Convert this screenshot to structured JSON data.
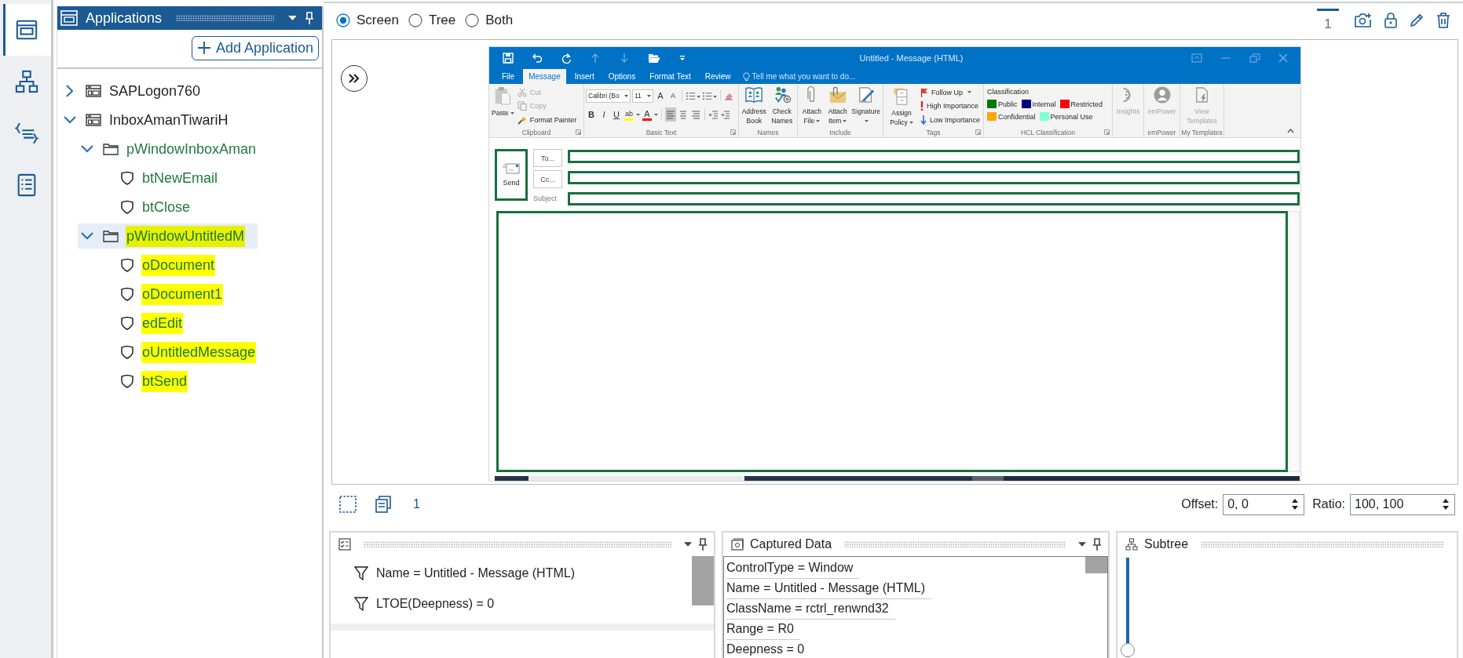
{
  "side_rail": [
    {
      "selected": true
    },
    {
      "selected": false
    },
    {
      "selected": false
    },
    {
      "selected": false
    }
  ],
  "applications": {
    "title": "Applications",
    "add_button": "Add Application",
    "tree": [
      {
        "label": "SAPLogon760",
        "kind": "application",
        "expanded": false,
        "selected": false,
        "highlighted": false
      },
      {
        "label": "InboxAmanTiwariH",
        "kind": "application",
        "expanded": true,
        "selected": false,
        "highlighted": false,
        "children": [
          {
            "label": "pWindowInboxAman",
            "kind": "window",
            "expanded": true,
            "selected": false,
            "highlighted": false,
            "children": [
              {
                "label": "btNewEmail",
                "kind": "element",
                "selected": false,
                "highlighted": false
              },
              {
                "label": "btClose",
                "kind": "element",
                "selected": false,
                "highlighted": false
              }
            ]
          },
          {
            "label": "pWindowUntitledM",
            "kind": "window",
            "expanded": true,
            "selected": true,
            "highlighted": true,
            "children": [
              {
                "label": "oDocument",
                "kind": "element",
                "selected": false,
                "highlighted": true
              },
              {
                "label": "oDocument1",
                "kind": "element",
                "selected": false,
                "highlighted": true
              },
              {
                "label": "edEdit",
                "kind": "element",
                "selected": false,
                "highlighted": true
              },
              {
                "label": "oUntitledMessage",
                "kind": "element",
                "selected": false,
                "highlighted": true
              },
              {
                "label": "btSend",
                "kind": "element",
                "selected": false,
                "highlighted": true
              }
            ]
          }
        ]
      }
    ]
  },
  "view_modes": [
    {
      "label": "Screen",
      "selected": true
    },
    {
      "label": "Tree",
      "selected": false
    },
    {
      "label": "Both",
      "selected": false
    }
  ],
  "screen_tabs": [
    {
      "label": "1",
      "selected": true
    }
  ],
  "outlook": {
    "title": "Untitled - Message (HTML)",
    "quick_access": [
      {
        "disabled": false
      },
      {
        "disabled": false
      },
      {
        "disabled": false
      },
      {
        "disabled": true
      },
      {
        "disabled": true
      },
      {
        "disabled": false
      },
      {
        "disabled": false
      }
    ],
    "tabs": [
      {
        "label": "File",
        "selected": false
      },
      {
        "label": "Message",
        "selected": true
      },
      {
        "label": "Insert",
        "selected": false
      },
      {
        "label": "Options",
        "selected": false
      },
      {
        "label": "Format Text",
        "selected": false
      },
      {
        "label": "Review",
        "selected": false
      }
    ],
    "tell_me": "Tell me what you want to do...",
    "ribbon": [
      {
        "kind": "clipboard",
        "label": "Clipboard",
        "launcher": true,
        "paste": {
          "label": "Paste",
          "dropdown": true
        },
        "items": [
          {
            "label": "Cut",
            "disabled": true
          },
          {
            "label": "Copy",
            "disabled": true
          },
          {
            "label": "Format Painter",
            "disabled": false
          }
        ]
      },
      {
        "kind": "basic_text",
        "label": "Basic Text",
        "launcher": true,
        "font": "Calibri (Bo",
        "size": "11",
        "grow": "A",
        "shrink": "A",
        "styles": [
          "B",
          "I",
          "U"
        ],
        "highlight": "ab",
        "font_color": "A",
        "alignments": [
          {
            "selected": true
          },
          {
            "selected": false
          },
          {
            "selected": false
          }
        ]
      },
      {
        "kind": "names",
        "label": "Names",
        "buttons": [
          {
            "label": "Address Book",
            "dropdown": false,
            "disabled": false
          },
          {
            "label": "Check Names",
            "dropdown": false,
            "disabled": false
          }
        ]
      },
      {
        "kind": "include",
        "label": "Include",
        "buttons": [
          {
            "label": "Attach File",
            "dropdown": true,
            "disabled": false
          },
          {
            "label": "Attach Item",
            "dropdown": true,
            "disabled": false
          },
          {
            "label": "Signature",
            "dropdown": true,
            "disabled": false
          }
        ]
      },
      {
        "kind": "tags",
        "label": "Tags",
        "launcher": true,
        "policy": {
          "label": "Assign Policy",
          "dropdown": true
        },
        "items": [
          {
            "label": "Follow Up",
            "dropdown": true
          },
          {
            "label": "High Importance",
            "dropdown": false
          },
          {
            "label": "Low Importance",
            "dropdown": false
          }
        ]
      },
      {
        "kind": "classification",
        "label": "HCL Classification",
        "launcher": true,
        "heading": "Classification",
        "tags": [
          {
            "label": "Public",
            "color": "#007a00"
          },
          {
            "label": "Internal",
            "color": "#00007f"
          },
          {
            "label": "Restricted",
            "color": "#ff0000"
          },
          {
            "label": "Confidential",
            "color": "#ffa500"
          },
          {
            "label": "Personal Use",
            "color": "#7fffd4"
          }
        ]
      },
      {
        "kind": "insights",
        "buttons": [
          {
            "label": "Insights",
            "dropdown": false,
            "disabled": true
          }
        ]
      },
      {
        "kind": "empower",
        "label": "emPower",
        "buttons": [
          {
            "label": "emPower",
            "dropdown": false,
            "disabled": true
          }
        ]
      },
      {
        "kind": "templates",
        "label": "My Templates",
        "buttons": [
          {
            "label": "View Templates",
            "dropdown": false,
            "disabled": true
          }
        ]
      }
    ],
    "message": {
      "send": {
        "label": "Send",
        "highlighted": true
      },
      "recipients": [
        {
          "label": "To...",
          "highlighted": true
        },
        {
          "label": "Cc...",
          "highlighted": true
        }
      ],
      "subject": {
        "label": "Subject",
        "highlighted": true
      },
      "body": {
        "highlighted": true
      }
    }
  },
  "capture_bar": {
    "count": "1",
    "offset_label": "Offset:",
    "offset": "0, 0",
    "ratio_label": "Ratio:",
    "ratio": "100, 100"
  },
  "filters": [
    "Name = Untitled - Message (HTML)",
    "LTOE(Deepness) = 0"
  ],
  "captured_data": {
    "title": "Captured Data",
    "items": [
      "ControlType = Window",
      "Name = Untitled - Message (HTML)",
      "ClassName = rctrl_renwnd32",
      "Range = R0",
      "Deepness = 0"
    ]
  },
  "subtree": {
    "title": "Subtree",
    "slider": {
      "level": 1
    }
  }
}
